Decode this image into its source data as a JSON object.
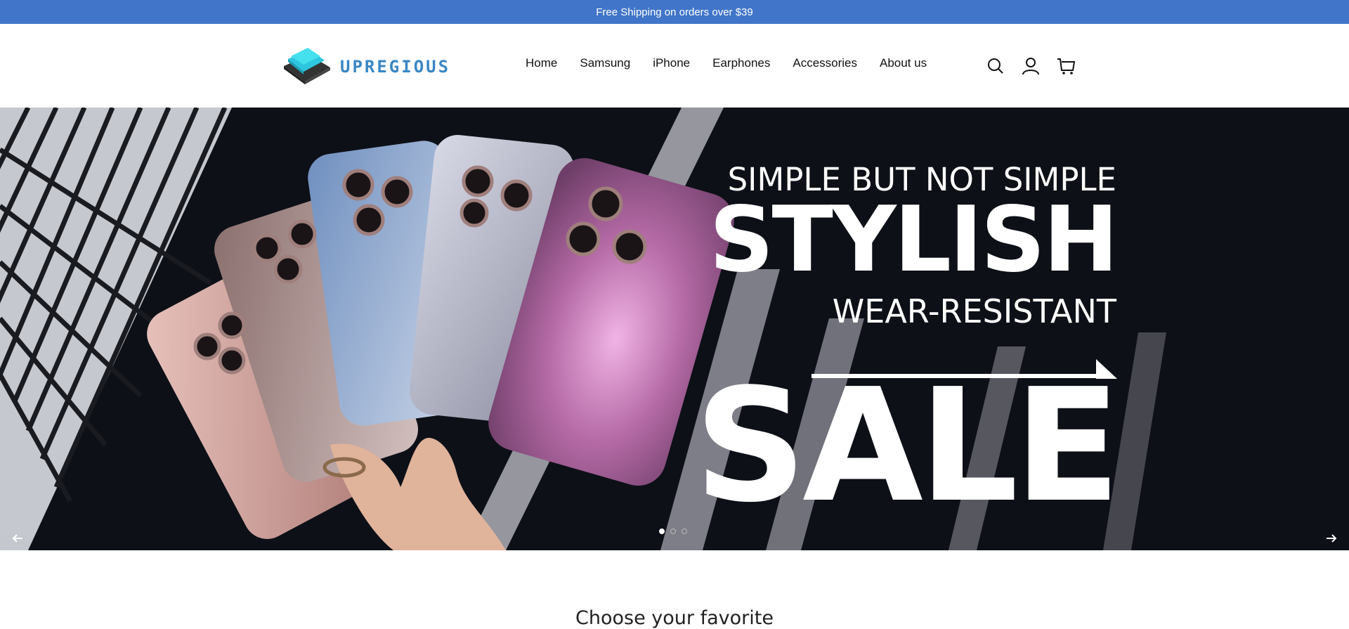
{
  "announcement": {
    "text": "Free Shipping on orders over $39"
  },
  "header": {
    "brand": "UPREGIOUS",
    "nav": [
      "Home",
      "Samsung",
      "iPhone",
      "Earphones",
      "Accessories",
      "About us"
    ],
    "icons": [
      "search-icon",
      "account-icon",
      "cart-icon"
    ]
  },
  "hero": {
    "line1": "SIMPLE BUT NOT SIMPLE",
    "line2": "STYLISH",
    "line3": "WEAR-RESISTANT",
    "line4": "SALE",
    "slides_total": 3,
    "active_slide": 1
  },
  "section": {
    "title": "Choose your favorite"
  },
  "colors": {
    "announce_bg": "#4175c9",
    "hero_bg": "#0d1017",
    "accent": "#3a86c4"
  }
}
